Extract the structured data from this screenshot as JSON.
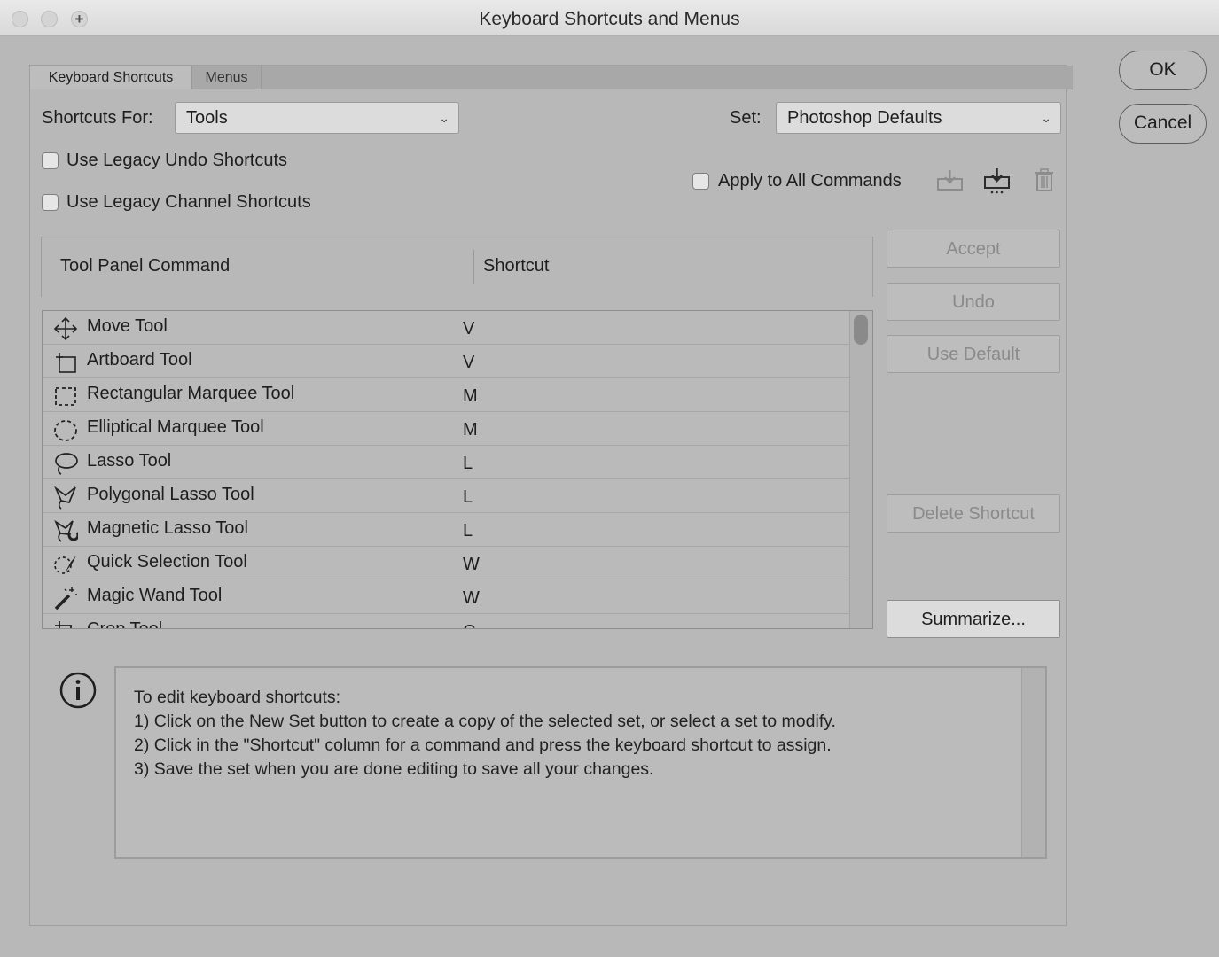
{
  "window": {
    "title": "Keyboard Shortcuts and Menus"
  },
  "tabs": [
    {
      "label": "Keyboard Shortcuts"
    },
    {
      "label": "Menus"
    }
  ],
  "shortcuts_for": {
    "label": "Shortcuts For:",
    "value": "Tools"
  },
  "set": {
    "label": "Set:",
    "value": "Photoshop Defaults"
  },
  "options": {
    "legacy_undo": "Use Legacy Undo Shortcuts",
    "legacy_channel": "Use Legacy Channel Shortcuts",
    "apply_all": "Apply to All Commands"
  },
  "table": {
    "col_command": "Tool Panel Command",
    "col_shortcut": "Shortcut",
    "rows": [
      {
        "command": "Move Tool",
        "shortcut": "V",
        "icon": "move-icon"
      },
      {
        "command": "Artboard Tool",
        "shortcut": "V",
        "icon": "artboard-icon"
      },
      {
        "command": "Rectangular Marquee Tool",
        "shortcut": "M",
        "icon": "rect-marquee-icon"
      },
      {
        "command": "Elliptical Marquee Tool",
        "shortcut": "M",
        "icon": "ellipse-marquee-icon"
      },
      {
        "command": "Lasso Tool",
        "shortcut": "L",
        "icon": "lasso-icon"
      },
      {
        "command": "Polygonal Lasso Tool",
        "shortcut": "L",
        "icon": "polygonal-lasso-icon"
      },
      {
        "command": "Magnetic Lasso Tool",
        "shortcut": "L",
        "icon": "magnetic-lasso-icon"
      },
      {
        "command": "Quick Selection Tool",
        "shortcut": "W",
        "icon": "quick-selection-icon"
      },
      {
        "command": "Magic Wand Tool",
        "shortcut": "W",
        "icon": "magic-wand-icon"
      },
      {
        "command": "Crop Tool",
        "shortcut": "C",
        "icon": "crop-icon"
      }
    ]
  },
  "buttons": {
    "ok": "OK",
    "cancel": "Cancel",
    "accept": "Accept",
    "undo": "Undo",
    "use_default": "Use Default",
    "delete_shortcut": "Delete Shortcut",
    "summarize": "Summarize..."
  },
  "info": {
    "lines": [
      "To edit keyboard shortcuts:",
      "1) Click on the New Set button to create a copy of the selected set, or select a set to modify.",
      "2) Click in the \"Shortcut\" column for a command and press the keyboard shortcut to assign.",
      "3) Save the set when you are done editing to save all your changes."
    ]
  }
}
